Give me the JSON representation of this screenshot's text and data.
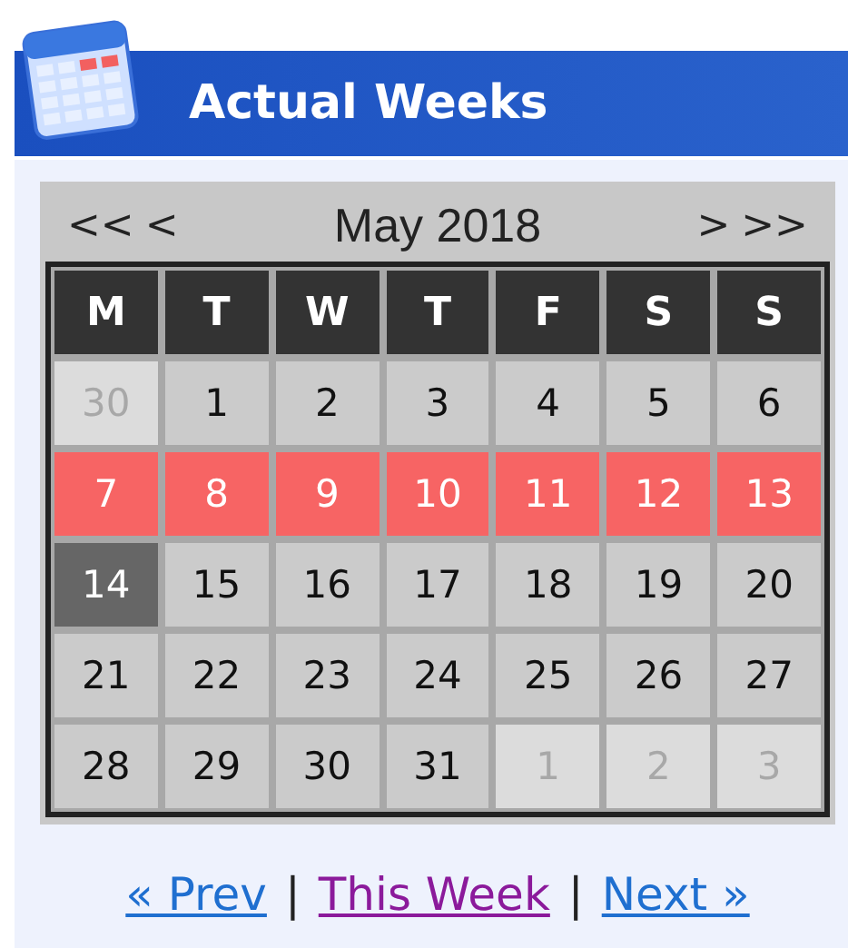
{
  "header": {
    "title": "Actual Weeks"
  },
  "calendar": {
    "nav_left": [
      "<<",
      "<"
    ],
    "month": "May 2018",
    "nav_right": [
      ">",
      ">>"
    ],
    "weekdays": [
      "M",
      "T",
      "W",
      "T",
      "F",
      "S",
      "S"
    ],
    "weeks": [
      [
        {
          "day": "30",
          "kind": "other_month"
        },
        {
          "day": "1",
          "kind": "plain"
        },
        {
          "day": "2",
          "kind": "plain"
        },
        {
          "day": "3",
          "kind": "plain"
        },
        {
          "day": "4",
          "kind": "plain"
        },
        {
          "day": "5",
          "kind": "plain"
        },
        {
          "day": "6",
          "kind": "plain"
        }
      ],
      [
        {
          "day": "7",
          "kind": "selected_week"
        },
        {
          "day": "8",
          "kind": "selected_week"
        },
        {
          "day": "9",
          "kind": "selected_week"
        },
        {
          "day": "10",
          "kind": "selected_week"
        },
        {
          "day": "11",
          "kind": "selected_week"
        },
        {
          "day": "12",
          "kind": "selected_week"
        },
        {
          "day": "13",
          "kind": "selected_week"
        }
      ],
      [
        {
          "day": "14",
          "kind": "today"
        },
        {
          "day": "15",
          "kind": "plain"
        },
        {
          "day": "16",
          "kind": "plain"
        },
        {
          "day": "17",
          "kind": "plain"
        },
        {
          "day": "18",
          "kind": "plain"
        },
        {
          "day": "19",
          "kind": "plain"
        },
        {
          "day": "20",
          "kind": "plain"
        }
      ],
      [
        {
          "day": "21",
          "kind": "plain"
        },
        {
          "day": "22",
          "kind": "plain"
        },
        {
          "day": "23",
          "kind": "plain"
        },
        {
          "day": "24",
          "kind": "plain"
        },
        {
          "day": "25",
          "kind": "plain"
        },
        {
          "day": "26",
          "kind": "plain"
        },
        {
          "day": "27",
          "kind": "plain"
        }
      ],
      [
        {
          "day": "28",
          "kind": "plain"
        },
        {
          "day": "29",
          "kind": "plain"
        },
        {
          "day": "30",
          "kind": "plain"
        },
        {
          "day": "31",
          "kind": "plain"
        },
        {
          "day": "1",
          "kind": "other_month"
        },
        {
          "day": "2",
          "kind": "other_month"
        },
        {
          "day": "3",
          "kind": "other_month"
        }
      ]
    ]
  },
  "links": [
    {
      "label": "« Prev",
      "visited": false
    },
    {
      "label": "This Week",
      "visited": true
    },
    {
      "label": "Next »",
      "visited": false
    }
  ],
  "separators": [
    "|",
    "|"
  ]
}
